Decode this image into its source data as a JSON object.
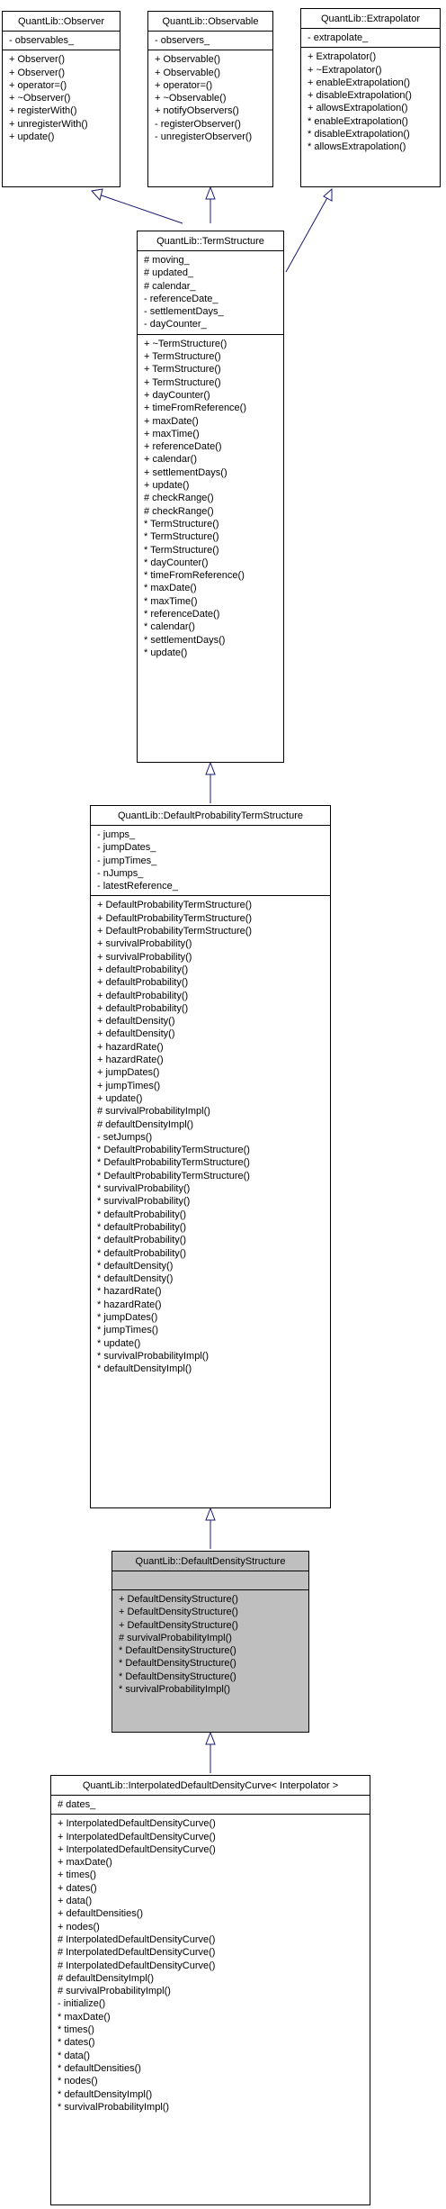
{
  "observer": {
    "title": "QuantLib::Observer",
    "attributes": [
      "- observables_"
    ],
    "methods": [
      "+ Observer()",
      "+ Observer()",
      "+ operator=()",
      "+ ~Observer()",
      "+ registerWith()",
      "+ unregisterWith()",
      "+ update()"
    ]
  },
  "observable": {
    "title": "QuantLib::Observable",
    "attributes": [
      "- observers_"
    ],
    "methods": [
      "+ Observable()",
      "+ Observable()",
      "+ operator=()",
      "+ ~Observable()",
      "+ notifyObservers()",
      "- registerObserver()",
      "- unregisterObserver()"
    ]
  },
  "extrapolator": {
    "title": "QuantLib::Extrapolator",
    "attributes": [
      "- extrapolate_"
    ],
    "methods": [
      "+ Extrapolator()",
      "+ ~Extrapolator()",
      "+ enableExtrapolation()",
      "+ disableExtrapolation()",
      "+ allowsExtrapolation()",
      "* enableExtrapolation()",
      "* disableExtrapolation()",
      "* allowsExtrapolation()"
    ]
  },
  "termstructure": {
    "title": "QuantLib::TermStructure",
    "attributes": [
      "# moving_",
      "# updated_",
      "# calendar_",
      "- referenceDate_",
      "- settlementDays_",
      "- dayCounter_"
    ],
    "methods": [
      "+ ~TermStructure()",
      "+ TermStructure()",
      "+ TermStructure()",
      "+ TermStructure()",
      "+ dayCounter()",
      "+ timeFromReference()",
      "+ maxDate()",
      "+ maxTime()",
      "+ referenceDate()",
      "+ calendar()",
      "+ settlementDays()",
      "+ update()",
      "# checkRange()",
      "# checkRange()",
      "* TermStructure()",
      "* TermStructure()",
      "* TermStructure()",
      "* dayCounter()",
      "* timeFromReference()",
      "* maxDate()",
      "* maxTime()",
      "* referenceDate()",
      "* calendar()",
      "* settlementDays()",
      "* update()"
    ]
  },
  "defaultprob": {
    "title": "QuantLib::DefaultProbabilityTermStructure",
    "attributes": [
      "- jumps_",
      "- jumpDates_",
      "- jumpTimes_",
      "- nJumps_",
      "- latestReference_"
    ],
    "methods": [
      "+ DefaultProbabilityTermStructure()",
      "+ DefaultProbabilityTermStructure()",
      "+ DefaultProbabilityTermStructure()",
      "+ survivalProbability()",
      "+ survivalProbability()",
      "+ defaultProbability()",
      "+ defaultProbability()",
      "+ defaultProbability()",
      "+ defaultProbability()",
      "+ defaultDensity()",
      "+ defaultDensity()",
      "+ hazardRate()",
      "+ hazardRate()",
      "+ jumpDates()",
      "+ jumpTimes()",
      "+ update()",
      "# survivalProbabilityImpl()",
      "# defaultDensityImpl()",
      "- setJumps()",
      "* DefaultProbabilityTermStructure()",
      "* DefaultProbabilityTermStructure()",
      "* DefaultProbabilityTermStructure()",
      "* survivalProbability()",
      "* survivalProbability()",
      "* defaultProbability()",
      "* defaultProbability()",
      "* defaultProbability()",
      "* defaultProbability()",
      "* defaultDensity()",
      "* defaultDensity()",
      "* hazardRate()",
      "* hazardRate()",
      "* jumpDates()",
      "* jumpTimes()",
      "* update()",
      "* survivalProbabilityImpl()",
      "* defaultDensityImpl()"
    ]
  },
  "defaultdensity": {
    "title": "QuantLib::DefaultDensityStructure",
    "attributes": [],
    "methods": [
      "+ DefaultDensityStructure()",
      "+ DefaultDensityStructure()",
      "+ DefaultDensityStructure()",
      "# survivalProbabilityImpl()",
      "* DefaultDensityStructure()",
      "* DefaultDensityStructure()",
      "* DefaultDensityStructure()",
      "* survivalProbabilityImpl()"
    ]
  },
  "interpolated": {
    "title": "QuantLib::InterpolatedDefaultDensityCurve< Interpolator >",
    "attributes": [
      "# dates_"
    ],
    "methods": [
      "+ InterpolatedDefaultDensityCurve()",
      "+ InterpolatedDefaultDensityCurve()",
      "+ InterpolatedDefaultDensityCurve()",
      "+ maxDate()",
      "+ times()",
      "+ dates()",
      "+ data()",
      "+ defaultDensities()",
      "+ nodes()",
      "# InterpolatedDefaultDensityCurve()",
      "# InterpolatedDefaultDensityCurve()",
      "# InterpolatedDefaultDensityCurve()",
      "# defaultDensityImpl()",
      "# survivalProbabilityImpl()",
      "- initialize()",
      "* maxDate()",
      "* times()",
      "* dates()",
      "* data()",
      "* defaultDensities()",
      "* nodes()",
      "* defaultDensityImpl()",
      "* survivalProbabilityImpl()"
    ]
  },
  "colors": {
    "arrow": "#191970",
    "highlight": "#bfbfbf",
    "border": "#000000"
  }
}
